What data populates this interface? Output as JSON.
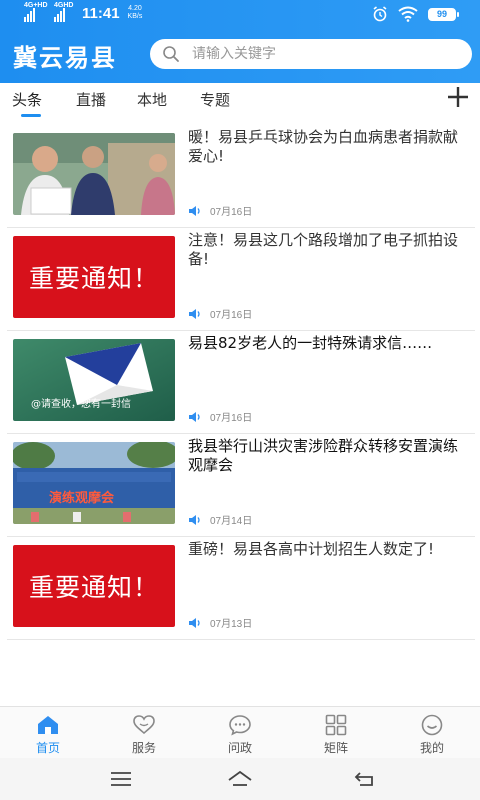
{
  "status_bar": {
    "network1": "4G+HD",
    "network2": "4GHD",
    "time": "11:41",
    "speed_value": "4.20",
    "speed_unit": "KB/s",
    "battery": "99"
  },
  "header": {
    "title": "冀云易县",
    "search_placeholder": "请输入关键字"
  },
  "tabs": [
    {
      "label": "头条",
      "active": true
    },
    {
      "label": "直播",
      "active": false
    },
    {
      "label": "本地",
      "active": false
    },
    {
      "label": "专题",
      "active": false
    }
  ],
  "news": [
    {
      "title": "暖！易县乒乓球协会为白血病患者捐款献爱心!",
      "date": "07月16日"
    },
    {
      "title": "注意！易县这几个路段增加了电子抓拍设备!",
      "date": "07月16日",
      "thumb_text": "重要通知！"
    },
    {
      "title": "易县82岁老人的一封特殊请求信……",
      "date": "07月16日",
      "thumb_text": "@请查收，您有一封信"
    },
    {
      "title": "我县举行山洪灾害涉险群众转移安置演练观摩会",
      "date": "07月14日",
      "thumb_text": "演练观摩会"
    },
    {
      "title": "重磅！易县各高中计划招生人数定了!",
      "date": "07月13日",
      "thumb_text": "重要通知！"
    }
  ],
  "bottom_nav": [
    {
      "label": "首页",
      "icon": "home-icon",
      "active": true
    },
    {
      "label": "服务",
      "icon": "heart-icon",
      "active": false
    },
    {
      "label": "问政",
      "icon": "chat-icon",
      "active": false
    },
    {
      "label": "矩阵",
      "icon": "grid-icon",
      "active": false
    },
    {
      "label": "我的",
      "icon": "user-icon",
      "active": false
    }
  ],
  "colors": {
    "primary": "#1e8ef0",
    "notice_red": "#d7111b",
    "date_gray": "#888888"
  }
}
